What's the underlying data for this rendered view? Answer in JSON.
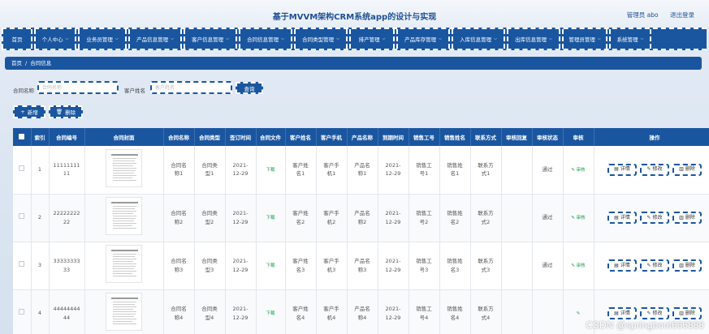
{
  "header": {
    "title": "基于MVVM架构CRM系统app的设计与实现",
    "user_label": "管理员 abo",
    "logout_label": "退出登录"
  },
  "nav": {
    "items": [
      {
        "label": "首页",
        "dropdown": false
      },
      {
        "label": "个人中心",
        "dropdown": true
      },
      {
        "label": "业务员管理",
        "dropdown": true
      },
      {
        "label": "产品信息管理",
        "dropdown": true
      },
      {
        "label": "客户信息管理",
        "dropdown": true
      },
      {
        "label": "合同信息管理",
        "dropdown": true
      },
      {
        "label": "合同类型管理",
        "dropdown": true
      },
      {
        "label": "排产管理",
        "dropdown": true
      },
      {
        "label": "产品库存管理",
        "dropdown": true
      },
      {
        "label": "入库信息管理",
        "dropdown": true
      },
      {
        "label": "出库信息管理",
        "dropdown": true
      },
      {
        "label": "管理员管理",
        "dropdown": true
      },
      {
        "label": "系统管理",
        "dropdown": true
      }
    ]
  },
  "breadcrumb": {
    "home": "首页",
    "separator": "/",
    "current": "合同信息"
  },
  "search": {
    "contract_name_label": "合同名称",
    "contract_name_placeholder": "合同名称",
    "customer_name_label": "客户姓名",
    "customer_name_placeholder": "客户姓名",
    "query_label": "查询"
  },
  "actions": {
    "add_label": "新增",
    "delete_label": "删除"
  },
  "table": {
    "columns": [
      "",
      "索引",
      "合同编号",
      "合同封面",
      "合同名称",
      "合同类型",
      "签订时间",
      "合同文件",
      "客户姓名",
      "客户手机",
      "产品名称",
      "到期时间",
      "销售工号",
      "销售姓名",
      "联系方式",
      "审核回复",
      "审核状态",
      "审核",
      "操作"
    ],
    "rows": [
      {
        "index": "1",
        "contract_no": "1111111111",
        "name": "合同名称1",
        "type": "合同类型1",
        "sign_time": "2021-12-29",
        "file": "下载",
        "customer": "客户姓名1",
        "phone": "客户手机1",
        "product": "产品名称1",
        "expire": "2021-12-29",
        "sales_no": "销售工号1",
        "sales_name": "销售姓名1",
        "contact": "联系方式1",
        "reply": "",
        "status": "通过",
        "review": "审核"
      },
      {
        "index": "2",
        "contract_no": "2222222222",
        "name": "合同名称2",
        "type": "合同类型2",
        "sign_time": "2021-12-29",
        "file": "下载",
        "customer": "客户姓名2",
        "phone": "客户手机2",
        "product": "产品名称2",
        "expire": "2021-12-29",
        "sales_no": "销售工号2",
        "sales_name": "销售姓名2",
        "contact": "联系方式2",
        "reply": "",
        "status": "通过",
        "review": "审核"
      },
      {
        "index": "3",
        "contract_no": "3333333333",
        "name": "合同名称3",
        "type": "合同类型3",
        "sign_time": "2021-12-29",
        "file": "下载",
        "customer": "客户姓名3",
        "phone": "客户手机3",
        "product": "产品名称3",
        "expire": "2021-12-29",
        "sales_no": "销售工号3",
        "sales_name": "销售姓名3",
        "contact": "联系方式3",
        "reply": "",
        "status": "通过",
        "review": "审核"
      },
      {
        "index": "4",
        "contract_no": "4444444444",
        "name": "合同名称4",
        "type": "合同类型4",
        "sign_time": "2021-12-29",
        "file": "下载",
        "customer": "客户姓名4",
        "phone": "客户手机4",
        "product": "产品名称4",
        "expire": "2021-12-29",
        "sales_no": "销售工号4",
        "sales_name": "销售姓名4",
        "contact": "联系方式4",
        "reply": "",
        "status": "",
        "review": ""
      }
    ],
    "op_labels": {
      "detail": "详情",
      "edit": "修改",
      "delete": "删除"
    }
  },
  "watermark": "CSDN @springboot666888",
  "colors": {
    "primary": "#1a56a0",
    "accent_green": "#1a9c4a",
    "title": "#1f4f93"
  }
}
